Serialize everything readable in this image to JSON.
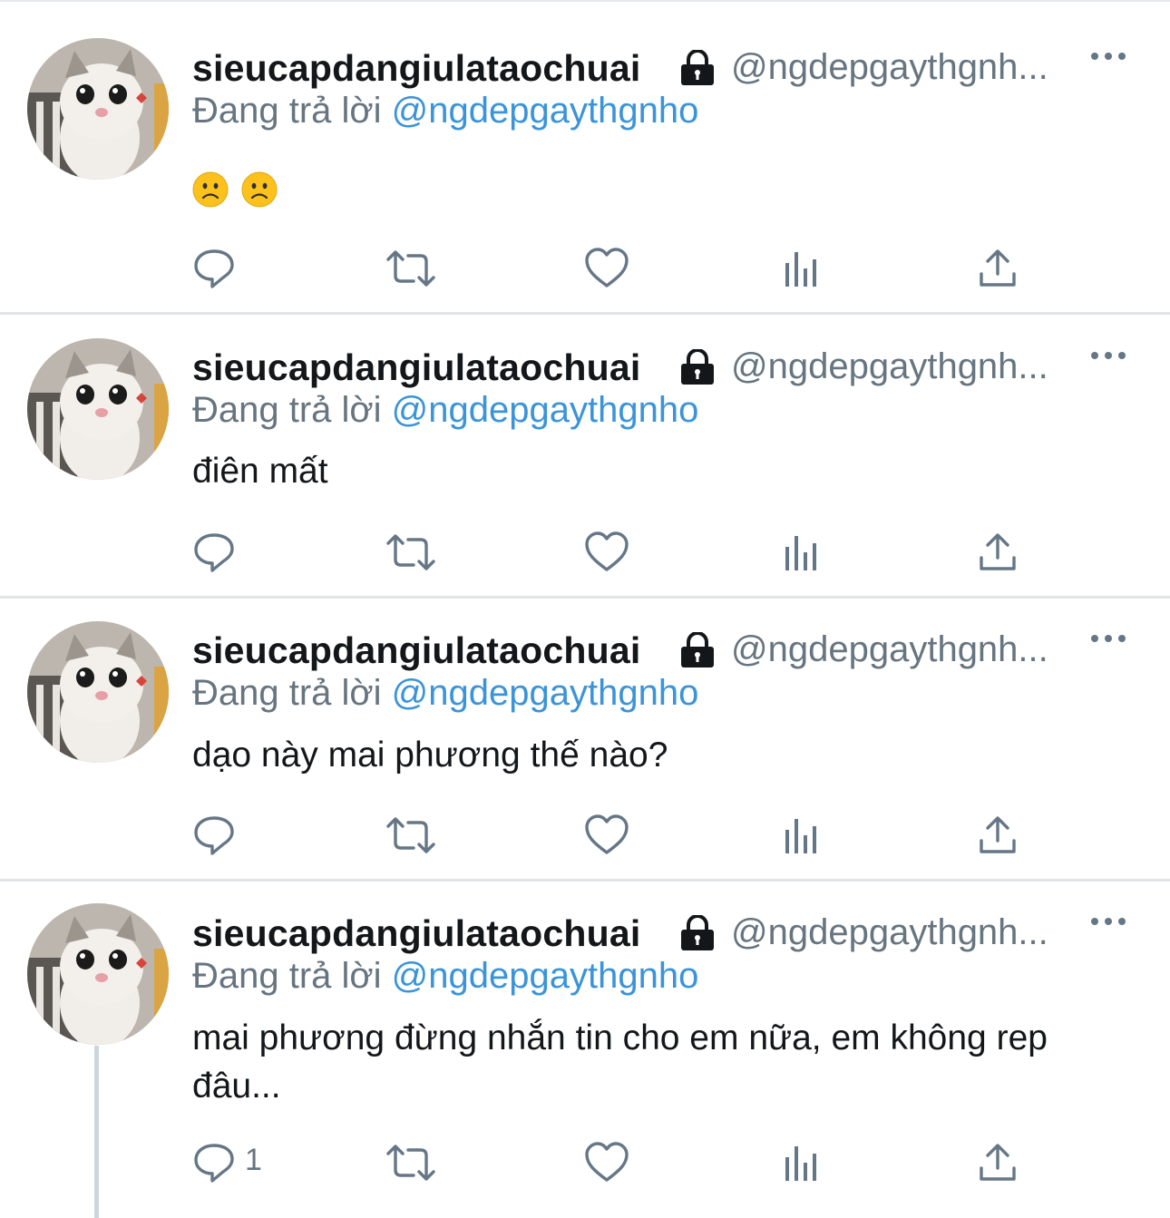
{
  "tweets": [
    {
      "username": "sieucapdangiulataochuai",
      "handle": "@ngdepgaythgnh...",
      "reply_prefix": "Đang trả lời",
      "reply_to": "@ngdepgaythgnho",
      "text": "🙁 🙁",
      "reply_count": ""
    },
    {
      "username": "sieucapdangiulataochuai",
      "handle": "@ngdepgaythgnh...",
      "reply_prefix": "Đang trả lời",
      "reply_to": "@ngdepgaythgnho",
      "text": "điên mất",
      "reply_count": ""
    },
    {
      "username": "sieucapdangiulataochuai",
      "handle": "@ngdepgaythgnh...",
      "reply_prefix": "Đang trả lời",
      "reply_to": "@ngdepgaythgnho",
      "text": "dạo này mai phương thế nào?",
      "reply_count": ""
    },
    {
      "username": "sieucapdangiulataochuai",
      "handle": "@ngdepgaythgnh...",
      "reply_prefix": "Đang trả lời",
      "reply_to": "@ngdepgaythgnho",
      "text": "mai phương đừng nhắn tin cho em nữa, em không rep đâu...",
      "reply_count": "1"
    }
  ],
  "icons": {
    "lock": "lock-icon",
    "more": "more-icon",
    "reply": "reply-icon",
    "retweet": "retweet-icon",
    "like": "heart-icon",
    "analytics": "analytics-icon",
    "share": "share-icon"
  },
  "colors": {
    "mention": "#3b94d9",
    "secondary_text": "#66757f",
    "icon": "#657786",
    "divider": "#e1e5e8"
  }
}
